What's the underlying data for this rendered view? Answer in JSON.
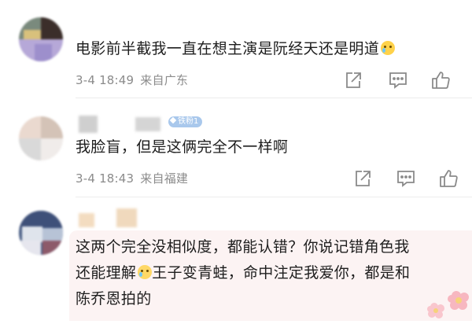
{
  "comments": [
    {
      "text": "电影前半截我一直在想主演是阮经天还是明道",
      "emoji": "sweat-laugh-emoji",
      "date": "3-4 18:49",
      "location": "来自广东"
    },
    {
      "text": "我脸盲，但是这俩完全不一样啊",
      "badge": "铁粉1",
      "date": "3-4 18:43",
      "location": "来自福建"
    },
    {
      "line1": "这两个完全没相似度，都能认错？你说记错角色我",
      "line2_a": "还能理解",
      "line2_b": "王子变青蛙，命中注定我爱你，都是和",
      "line3": "陈乔恩拍的"
    }
  ],
  "icons": {
    "share": "share-icon",
    "comment": "comment-icon",
    "like": "like-icon",
    "flower": "flower-sticker-icon"
  },
  "colors": {
    "meta_text": "#8b8b8b",
    "badge_bg": "#a9c8ec",
    "icon_stroke": "#8a8a8a",
    "highlight_bg": "#fcf3f3"
  }
}
